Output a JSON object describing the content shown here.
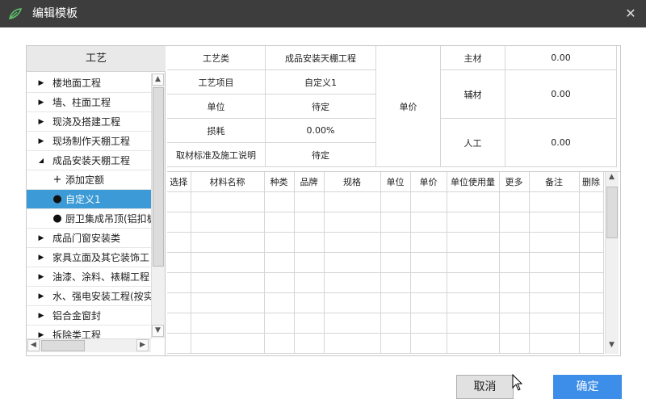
{
  "window": {
    "title": "编辑模板",
    "close_glyph": "✕",
    "logo_icon": "leaf-logo-icon"
  },
  "tree": {
    "header": "工艺",
    "items": [
      {
        "label": "楼地面工程",
        "expanded": false,
        "level": 0
      },
      {
        "label": "墙、柱面工程",
        "expanded": false,
        "level": 0
      },
      {
        "label": "现浇及搭建工程",
        "expanded": false,
        "level": 0
      },
      {
        "label": "现场制作天棚工程",
        "expanded": false,
        "level": 0
      },
      {
        "label": "成品安装天棚工程",
        "expanded": true,
        "level": 0
      },
      {
        "label": "添加定额",
        "level": 1,
        "icon": "+"
      },
      {
        "label": "自定义1",
        "level": 1,
        "icon": "●",
        "selected": true
      },
      {
        "label": "厨卫集成吊顶(铝扣板",
        "level": 1,
        "icon": "●"
      },
      {
        "label": "成品门窗安装类",
        "expanded": false,
        "level": 0
      },
      {
        "label": "家具立面及其它装饰工",
        "expanded": false,
        "level": 0
      },
      {
        "label": "油漆、涂料、裱糊工程",
        "expanded": false,
        "level": 0
      },
      {
        "label": "水、强电安装工程(按实",
        "expanded": false,
        "level": 0
      },
      {
        "label": "铝合金窗封",
        "expanded": false,
        "level": 0
      },
      {
        "label": "拆除类工程",
        "expanded": false,
        "level": 0
      }
    ]
  },
  "info": {
    "craft_type_label": "工艺类",
    "craft_type_value": "成品安装天棚工程",
    "craft_item_label": "工艺项目",
    "craft_item_value": "自定义1",
    "unit_label": "单位",
    "unit_value": "待定",
    "loss_label": "损耗",
    "loss_value": "0.00%",
    "standard_label": "取材标准及施工说明",
    "standard_value": "待定",
    "unit_price_label": "单价",
    "main_material_label": "主材",
    "main_material_value": "0.00",
    "aux_material_label": "辅材",
    "aux_material_value": "0.00",
    "labor_label": "人工",
    "labor_value": "0.00"
  },
  "grid": {
    "columns": [
      "选择",
      "材料名称",
      "种类",
      "品牌",
      "规格",
      "单位",
      "单价",
      "单位使用量",
      "更多",
      "备注",
      "删除"
    ],
    "rows": []
  },
  "buttons": {
    "cancel": "取消",
    "ok": "确定"
  }
}
